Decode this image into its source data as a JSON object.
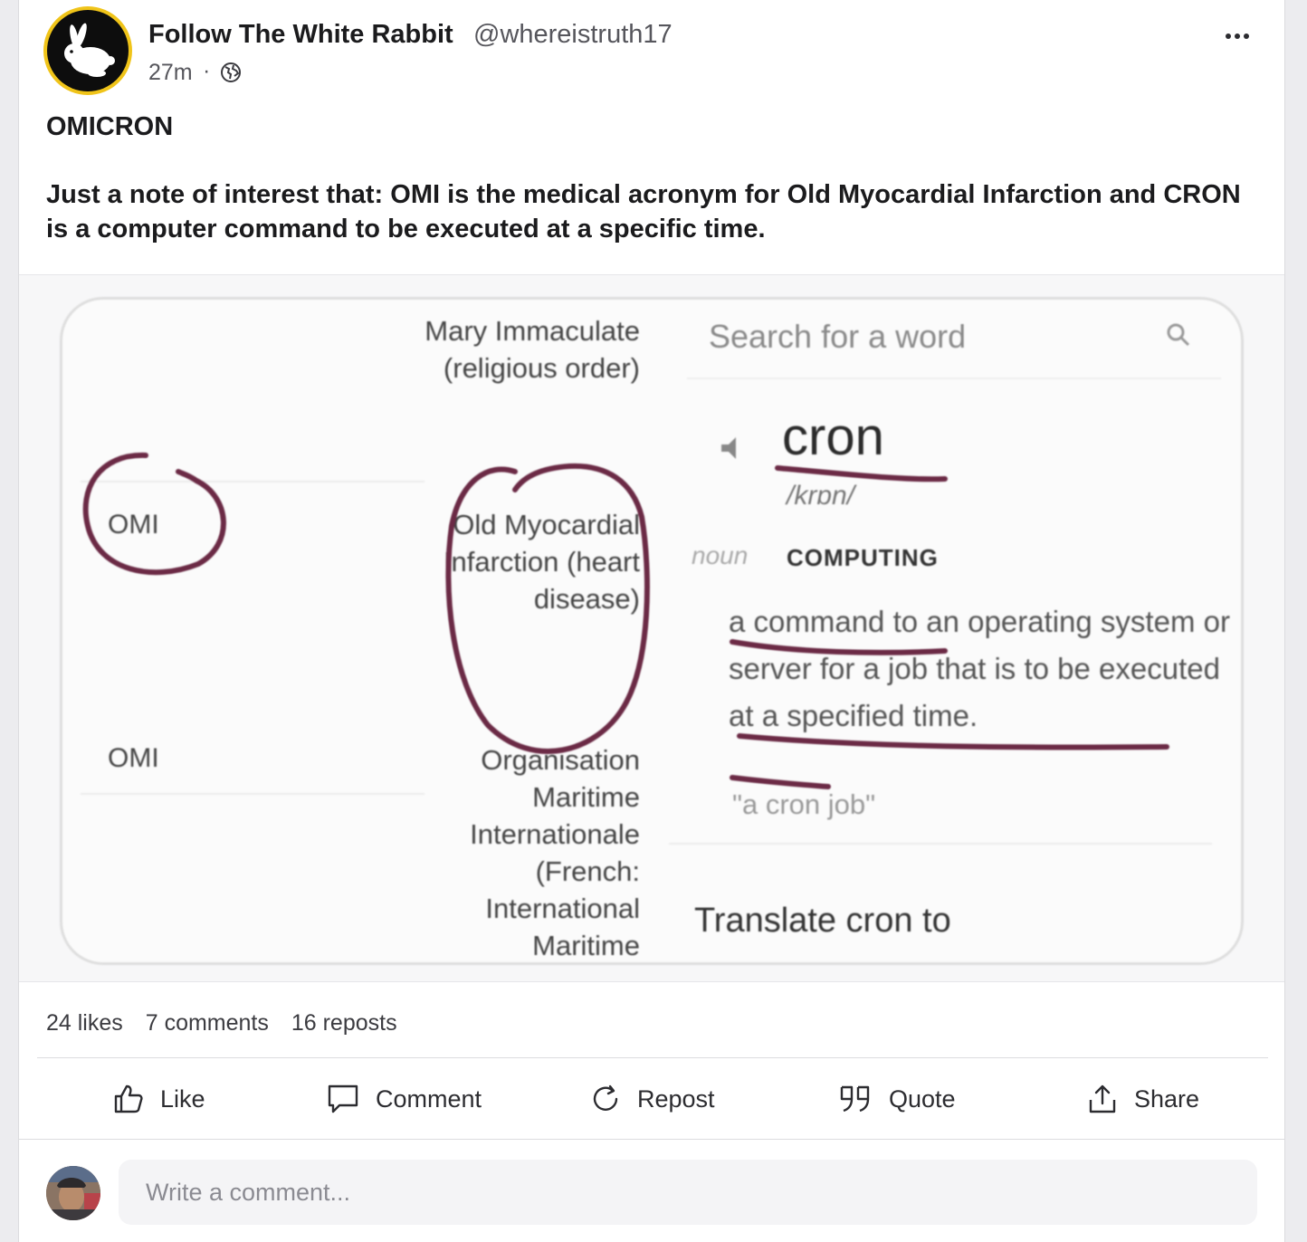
{
  "post": {
    "author_name": "Follow The White Rabbit",
    "author_handle": "@whereistruth17",
    "time": "27m",
    "separator": "·",
    "visibility_icon": "globe-icon",
    "title": "OMICRON",
    "body": "Just a note of interest that: OMI is the medical acronym for Old Myocardial Infarction and CRON is a computer command to be executed at a specific time."
  },
  "image": {
    "rows": [
      {
        "abbr": "",
        "meaning": "Mary Immaculate (religious order)"
      },
      {
        "abbr": "OMI",
        "meaning": "Old Myocardial Infarction (heart disease)"
      },
      {
        "abbr": "OMI",
        "meaning": "Organisation Maritime Internationale (French: International Maritime"
      }
    ],
    "dictionary": {
      "search_placeholder": "Search for a word",
      "word": "cron",
      "pronunciation": "/krɒn/",
      "part_of_speech": "noun",
      "domain": "COMPUTING",
      "definition": "a command to an operating system or server for a job that is to be executed at a specified time.",
      "example": "\"a cron job\"",
      "translate": "Translate cron to"
    },
    "annotation_color": "#6b2a45"
  },
  "stats": {
    "likes": "24 likes",
    "comments": "7 comments",
    "reposts": "16 reposts"
  },
  "actions": {
    "like": "Like",
    "comment": "Comment",
    "repost": "Repost",
    "quote": "Quote",
    "share": "Share"
  },
  "comment_input": {
    "placeholder": "Write a comment..."
  },
  "colors": {
    "avatar_ring": "#f0c419",
    "text_primary": "#1b1b1d",
    "text_secondary": "#56565c"
  }
}
